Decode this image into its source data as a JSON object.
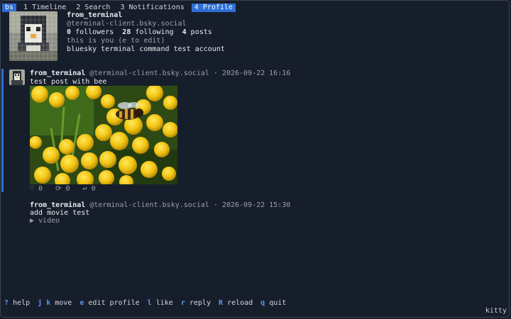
{
  "app_badge": "bs",
  "tabs": [
    {
      "label": "1 Timeline"
    },
    {
      "label": "2 Search"
    },
    {
      "label": "3 Notifications"
    },
    {
      "label": "4 Profile"
    }
  ],
  "profile": {
    "display_name": "from_terminal",
    "handle": "@terminal-client.bsky.social",
    "followers_count": "0",
    "followers_label": "followers",
    "following_count": "28",
    "following_label": "following",
    "posts_count": "4",
    "posts_label": "posts",
    "self_note": "this is you (e to edit)",
    "bio": "bluesky terminal command test account"
  },
  "posts": [
    {
      "author": "from_terminal",
      "meta": " @terminal-client.bsky.social · 2026-09-22 16:16",
      "text": "test post with bee",
      "stats": "♡ 0   ⟳ 0   ↩ 0"
    },
    {
      "author": "from_terminal",
      "meta": " @terminal-client.bsky.social · 2026-09-22 15:30",
      "text": "add movie test",
      "video_label": "▶ video"
    }
  ],
  "footer": [
    {
      "key": "?",
      "desc": "help"
    },
    {
      "key": "j k",
      "desc": "move"
    },
    {
      "key": "e",
      "desc": "edit profile"
    },
    {
      "key": "l",
      "desc": "like"
    },
    {
      "key": "r",
      "desc": "reply"
    },
    {
      "key": "R",
      "desc": "reload"
    },
    {
      "key": "q",
      "desc": "quit"
    }
  ],
  "window_label": "kitty",
  "colors": {
    "background": "#171e2b",
    "accent": "#2d6fd6",
    "key": "#5e97ee"
  }
}
